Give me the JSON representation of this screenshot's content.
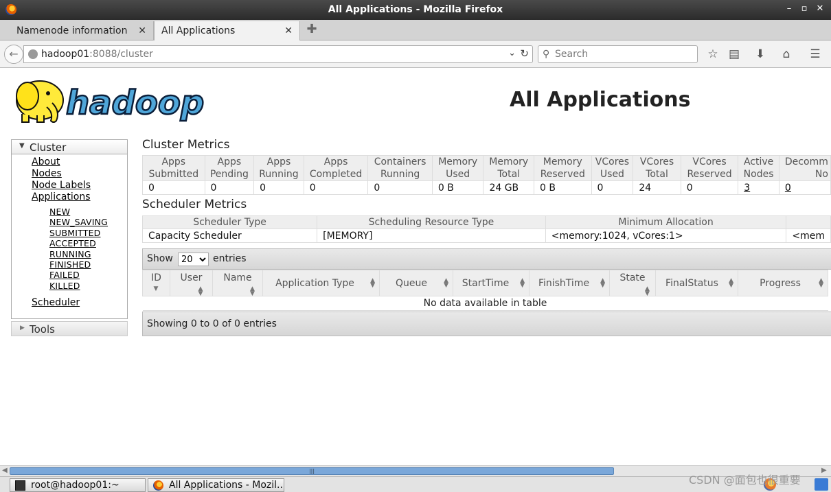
{
  "window": {
    "title": "All Applications - Mozilla Firefox",
    "minimize": "–",
    "maximize": "▫",
    "close": "✕"
  },
  "tabs": [
    {
      "label": "Namenode information",
      "close": "✕"
    },
    {
      "label": "All Applications",
      "close": "✕"
    }
  ],
  "nav": {
    "url_host": "hadoop01",
    "url_path": ":8088/cluster",
    "search_placeholder": "Search",
    "back_icon": "arrow-left-icon",
    "icons": [
      "star-icon",
      "reader-icon",
      "download-icon",
      "home-icon",
      "menu-icon"
    ]
  },
  "page": {
    "logo_text": "hadoop",
    "title": "All Applications"
  },
  "sidebar": {
    "cluster_label": "Cluster",
    "links": [
      "About",
      "Nodes",
      "Node Labels",
      "Applications"
    ],
    "app_states": [
      "NEW",
      "NEW_SAVING",
      "SUBMITTED",
      "ACCEPTED",
      "RUNNING",
      "FINISHED",
      "FAILED",
      "KILLED"
    ],
    "scheduler": "Scheduler",
    "tools_label": "Tools"
  },
  "cluster_metrics": {
    "title": "Cluster Metrics",
    "headers": [
      [
        "Apps",
        "Submitted"
      ],
      [
        "Apps",
        "Pending"
      ],
      [
        "Apps",
        "Running"
      ],
      [
        "Apps",
        "Completed"
      ],
      [
        "Containers",
        "Running"
      ],
      [
        "Memory",
        "Used"
      ],
      [
        "Memory",
        "Total"
      ],
      [
        "Memory",
        "Reserved"
      ],
      [
        "VCores",
        "Used"
      ],
      [
        "VCores",
        "Total"
      ],
      [
        "VCores",
        "Reserved"
      ],
      [
        "Active",
        "Nodes"
      ],
      [
        "Decomm",
        "No"
      ]
    ],
    "values": [
      "0",
      "0",
      "0",
      "0",
      "0",
      "0 B",
      "24 GB",
      "0 B",
      "0",
      "24",
      "0",
      "3",
      "0"
    ]
  },
  "scheduler_metrics": {
    "title": "Scheduler Metrics",
    "headers": [
      "Scheduler Type",
      "Scheduling Resource Type",
      "Minimum Allocation",
      ""
    ],
    "values": [
      "Capacity Scheduler",
      "[MEMORY]",
      "<memory:1024, vCores:1>",
      "<mem"
    ]
  },
  "apps_table": {
    "show_label": "Show",
    "entries_label": "entries",
    "page_size": "20",
    "headers": [
      "ID",
      "User",
      "Name",
      "Application Type",
      "Queue",
      "StartTime",
      "FinishTime",
      "State",
      "FinalStatus",
      "Progress"
    ],
    "empty_message": "No data available in table",
    "info": "Showing 0 to 0 of 0 entries"
  },
  "taskbar": {
    "items": [
      "root@hadoop01:~",
      "All Applications - Mozil..."
    ],
    "watermark": "CSDN @面包也很重要"
  }
}
